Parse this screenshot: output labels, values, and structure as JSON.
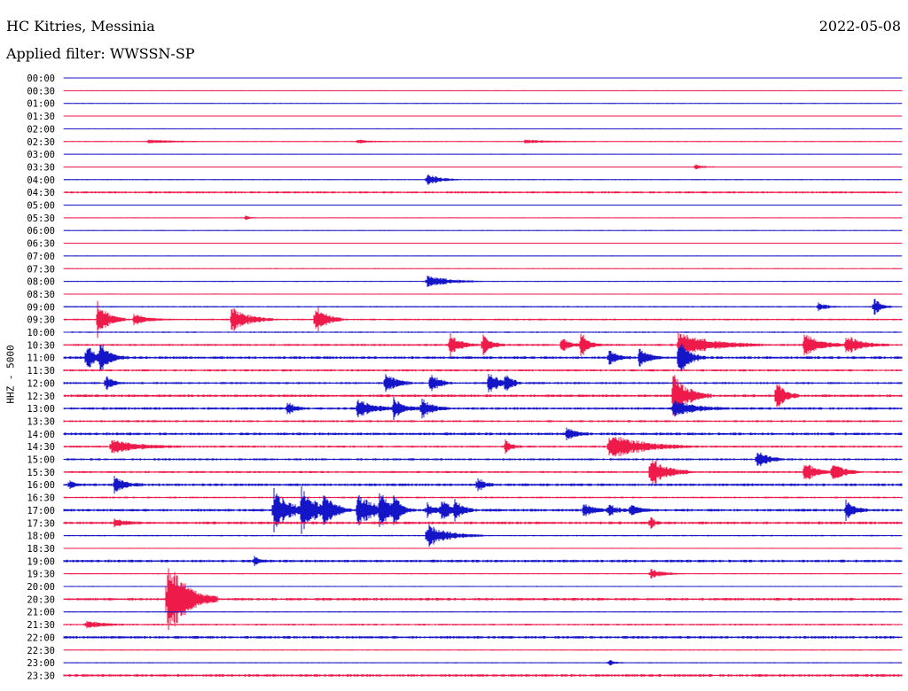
{
  "header": {
    "station": "HC Kitries, Messinia",
    "date": "2022-05-08",
    "filter_label": "Applied filter: WWSSN-SP"
  },
  "chart_data": {
    "type": "line",
    "title": "HC Kitries, Messinia",
    "date": "2022-05-08",
    "filter": "Applied filter: WWSSN-SP",
    "ylabel": "HHZ - 5000",
    "xlabel": "",
    "colors": {
      "even_trace": "#1515c8",
      "odd_trace": "#ee1a4a",
      "background": "#ffffff"
    },
    "trace_duration_minutes": 30,
    "times": [
      "00:00",
      "00:30",
      "01:00",
      "01:30",
      "02:00",
      "02:30",
      "03:00",
      "03:30",
      "04:00",
      "04:30",
      "05:00",
      "05:30",
      "06:00",
      "06:30",
      "07:00",
      "07:30",
      "08:00",
      "08:30",
      "09:00",
      "09:30",
      "10:00",
      "10:30",
      "11:00",
      "11:30",
      "12:00",
      "12:30",
      "13:00",
      "13:30",
      "14:00",
      "14:30",
      "15:00",
      "15:30",
      "16:00",
      "16:30",
      "17:00",
      "17:30",
      "18:00",
      "18:30",
      "19:00",
      "19:30",
      "20:00",
      "20:30",
      "21:00",
      "21:30",
      "22:00",
      "22:30",
      "23:00",
      "23:30"
    ],
    "noise_level": [
      0.5,
      0.5,
      0.5,
      0.5,
      0.5,
      0.6,
      0.5,
      0.5,
      0.6,
      1.2,
      0.5,
      0.5,
      0.5,
      0.5,
      0.5,
      0.5,
      0.6,
      0.6,
      0.8,
      1.0,
      0.8,
      1.2,
      1.5,
      1.2,
      1.2,
      1.5,
      1.4,
      1.2,
      1.5,
      1.2,
      1.2,
      1.2,
      1.5,
      1.0,
      1.5,
      1.5,
      0.8,
      0.6,
      1.5,
      0.6,
      0.6,
      1.5,
      0.6,
      1.0,
      1.5,
      0.6,
      0.6,
      1.5
    ],
    "events": [
      {
        "trace": 5,
        "minute": 3.0,
        "amplitude": 2,
        "duration": 2.5
      },
      {
        "trace": 5,
        "minute": 10.5,
        "amplitude": 2,
        "duration": 1.5
      },
      {
        "trace": 5,
        "minute": 16.5,
        "amplitude": 2,
        "duration": 2.5
      },
      {
        "trace": 7,
        "minute": 22.6,
        "amplitude": 3,
        "duration": 0.8
      },
      {
        "trace": 8,
        "minute": 13.0,
        "amplitude": 7,
        "duration": 1.2
      },
      {
        "trace": 11,
        "minute": 6.5,
        "amplitude": 3,
        "duration": 0.4
      },
      {
        "trace": 16,
        "minute": 13.0,
        "amplitude": 8,
        "duration": 2.0
      },
      {
        "trace": 18,
        "minute": 27.0,
        "amplitude": 5,
        "duration": 0.8
      },
      {
        "trace": 18,
        "minute": 29.0,
        "amplitude": 12,
        "duration": 0.6
      },
      {
        "trace": 19,
        "minute": 1.2,
        "amplitude": 24,
        "duration": 1.0
      },
      {
        "trace": 19,
        "minute": 2.5,
        "amplitude": 7,
        "duration": 1.2
      },
      {
        "trace": 19,
        "minute": 6.0,
        "amplitude": 16,
        "duration": 1.5
      },
      {
        "trace": 19,
        "minute": 9.0,
        "amplitude": 20,
        "duration": 1.0
      },
      {
        "trace": 21,
        "minute": 13.8,
        "amplitude": 14,
        "duration": 1.0
      },
      {
        "trace": 21,
        "minute": 15.0,
        "amplitude": 12,
        "duration": 0.8
      },
      {
        "trace": 21,
        "minute": 17.8,
        "amplitude": 10,
        "duration": 0.8
      },
      {
        "trace": 21,
        "minute": 18.5,
        "amplitude": 8,
        "duration": 0.6
      },
      {
        "trace": 21,
        "minute": 18.5,
        "amplitude": 10,
        "duration": 0.8
      },
      {
        "trace": 21,
        "minute": 22.0,
        "amplitude": 15,
        "duration": 3.0
      },
      {
        "trace": 21,
        "minute": 26.5,
        "amplitude": 14,
        "duration": 1.5
      },
      {
        "trace": 21,
        "minute": 28.0,
        "amplitude": 12,
        "duration": 1.5
      },
      {
        "trace": 22,
        "minute": 0.8,
        "amplitude": 16,
        "duration": 1.0
      },
      {
        "trace": 22,
        "minute": 1.3,
        "amplitude": 14,
        "duration": 1.0
      },
      {
        "trace": 22,
        "minute": 19.5,
        "amplitude": 10,
        "duration": 0.8
      },
      {
        "trace": 22,
        "minute": 20.6,
        "amplitude": 12,
        "duration": 0.8
      },
      {
        "trace": 22,
        "minute": 22.0,
        "amplitude": 22,
        "duration": 1.0
      },
      {
        "trace": 24,
        "minute": 1.5,
        "amplitude": 10,
        "duration": 0.6
      },
      {
        "trace": 24,
        "minute": 11.5,
        "amplitude": 14,
        "duration": 1.0
      },
      {
        "trace": 24,
        "minute": 13.1,
        "amplitude": 14,
        "duration": 0.8
      },
      {
        "trace": 24,
        "minute": 15.2,
        "amplitude": 14,
        "duration": 1.0
      },
      {
        "trace": 24,
        "minute": 15.8,
        "amplitude": 12,
        "duration": 0.6
      },
      {
        "trace": 25,
        "minute": 21.8,
        "amplitude": 28,
        "duration": 1.4
      },
      {
        "trace": 25,
        "minute": 25.5,
        "amplitude": 20,
        "duration": 0.8
      },
      {
        "trace": 26,
        "minute": 8.0,
        "amplitude": 8,
        "duration": 0.8
      },
      {
        "trace": 26,
        "minute": 10.5,
        "amplitude": 12,
        "duration": 1.5
      },
      {
        "trace": 26,
        "minute": 11.8,
        "amplitude": 12,
        "duration": 1.0
      },
      {
        "trace": 26,
        "minute": 12.8,
        "amplitude": 12,
        "duration": 1.0
      },
      {
        "trace": 26,
        "minute": 21.8,
        "amplitude": 10,
        "duration": 2.0
      },
      {
        "trace": 28,
        "minute": 18.0,
        "amplitude": 8,
        "duration": 0.8
      },
      {
        "trace": 29,
        "minute": 1.7,
        "amplitude": 8,
        "duration": 2.5
      },
      {
        "trace": 29,
        "minute": 15.8,
        "amplitude": 8,
        "duration": 0.6
      },
      {
        "trace": 29,
        "minute": 19.5,
        "amplitude": 16,
        "duration": 3.0
      },
      {
        "trace": 30,
        "minute": 24.8,
        "amplitude": 12,
        "duration": 1.0
      },
      {
        "trace": 31,
        "minute": 21.0,
        "amplitude": 18,
        "duration": 1.5
      },
      {
        "trace": 31,
        "minute": 26.5,
        "amplitude": 14,
        "duration": 1.0
      },
      {
        "trace": 31,
        "minute": 27.5,
        "amplitude": 14,
        "duration": 1.0
      },
      {
        "trace": 32,
        "minute": 0.2,
        "amplitude": 6,
        "duration": 0.5
      },
      {
        "trace": 32,
        "minute": 1.8,
        "amplitude": 10,
        "duration": 1.0
      },
      {
        "trace": 32,
        "minute": 14.8,
        "amplitude": 10,
        "duration": 0.6
      },
      {
        "trace": 34,
        "minute": 7.5,
        "amplitude": 26,
        "duration": 1.5
      },
      {
        "trace": 34,
        "minute": 8.5,
        "amplitude": 26,
        "duration": 1.5
      },
      {
        "trace": 34,
        "minute": 9.3,
        "amplitude": 16,
        "duration": 1.0
      },
      {
        "trace": 34,
        "minute": 10.5,
        "amplitude": 22,
        "duration": 1.5
      },
      {
        "trace": 34,
        "minute": 11.3,
        "amplitude": 20,
        "duration": 1.0
      },
      {
        "trace": 34,
        "minute": 11.8,
        "amplitude": 14,
        "duration": 0.8
      },
      {
        "trace": 34,
        "minute": 13.5,
        "amplitude": 12,
        "duration": 1.0
      },
      {
        "trace": 34,
        "minute": 14.0,
        "amplitude": 10,
        "duration": 0.8
      },
      {
        "trace": 34,
        "minute": 13.0,
        "amplitude": 8,
        "duration": 1.0
      },
      {
        "trace": 34,
        "minute": 18.6,
        "amplitude": 8,
        "duration": 1.0
      },
      {
        "trace": 34,
        "minute": 19.5,
        "amplitude": 8,
        "duration": 0.8
      },
      {
        "trace": 34,
        "minute": 20.3,
        "amplitude": 8,
        "duration": 0.8
      },
      {
        "trace": 34,
        "minute": 28.0,
        "amplitude": 12,
        "duration": 0.8
      },
      {
        "trace": 35,
        "minute": 1.8,
        "amplitude": 5,
        "duration": 1.0
      },
      {
        "trace": 35,
        "minute": 21.0,
        "amplitude": 8,
        "duration": 0.4
      },
      {
        "trace": 36,
        "minute": 13.0,
        "amplitude": 14,
        "duration": 2.0
      },
      {
        "trace": 38,
        "minute": 6.8,
        "amplitude": 6,
        "duration": 0.5
      },
      {
        "trace": 39,
        "minute": 21.0,
        "amplitude": 6,
        "duration": 1.2
      },
      {
        "trace": 41,
        "minute": 3.7,
        "amplitude": 50,
        "duration": 1.8
      },
      {
        "trace": 43,
        "minute": 0.8,
        "amplitude": 5,
        "duration": 1.5
      },
      {
        "trace": 46,
        "minute": 19.5,
        "amplitude": 4,
        "duration": 0.6
      }
    ]
  }
}
